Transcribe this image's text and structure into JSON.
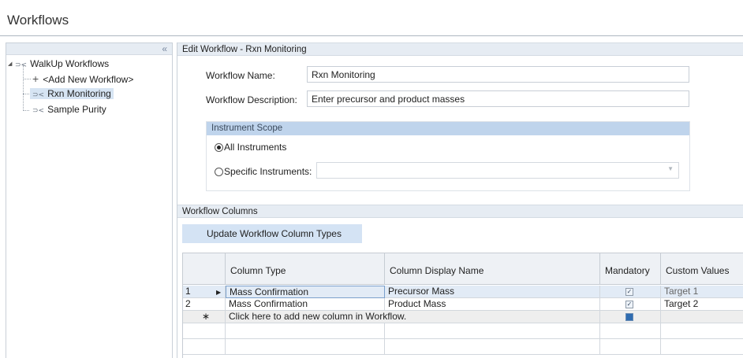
{
  "app": {
    "title": "Workflows"
  },
  "tree": {
    "collapse_glyph": "«",
    "root": {
      "label": "WalkUp Workflows",
      "expander": "◢",
      "icon": "workflow-icon"
    },
    "add": {
      "label": "<Add New Workflow>",
      "icon": "plus-icon"
    },
    "items": [
      {
        "label": "Rxn Monitoring",
        "selected": true
      },
      {
        "label": "Sample Purity",
        "selected": false
      }
    ]
  },
  "edit": {
    "header": "Edit Workflow - Rxn Monitoring",
    "name_label": "Workflow Name:",
    "name_value": "Rxn Monitoring",
    "desc_label": "Workflow Description:",
    "desc_value": "Enter precursor and product masses",
    "scope": {
      "header": "Instrument Scope",
      "all_label": "All Instruments",
      "all_selected": true,
      "specific_label": "Specific Instruments:",
      "specific_value": ""
    }
  },
  "columns": {
    "header": "Workflow Columns",
    "update_button": "Update Workflow Column Types",
    "grid_headers": [
      "Column Type",
      "Column Display Name",
      "Mandatory",
      "Custom Values"
    ],
    "rows": [
      {
        "num": "1",
        "type": "Mass Confirmation",
        "display": "Precursor Mass",
        "mandatory": true,
        "custom": "Target 1",
        "current": true
      },
      {
        "num": "2",
        "type": "Mass Confirmation",
        "display": "Product Mass",
        "mandatory": true,
        "custom": "Target 2",
        "current": false
      }
    ],
    "new_row": {
      "marker": "∗",
      "text": "Click here to add new column in Workflow."
    }
  },
  "colors": {
    "accent": "#d4e3f4",
    "selection": "#d6e4f3",
    "header_bg": "#e6ecf3",
    "scope_header": "#bfd4ec"
  }
}
